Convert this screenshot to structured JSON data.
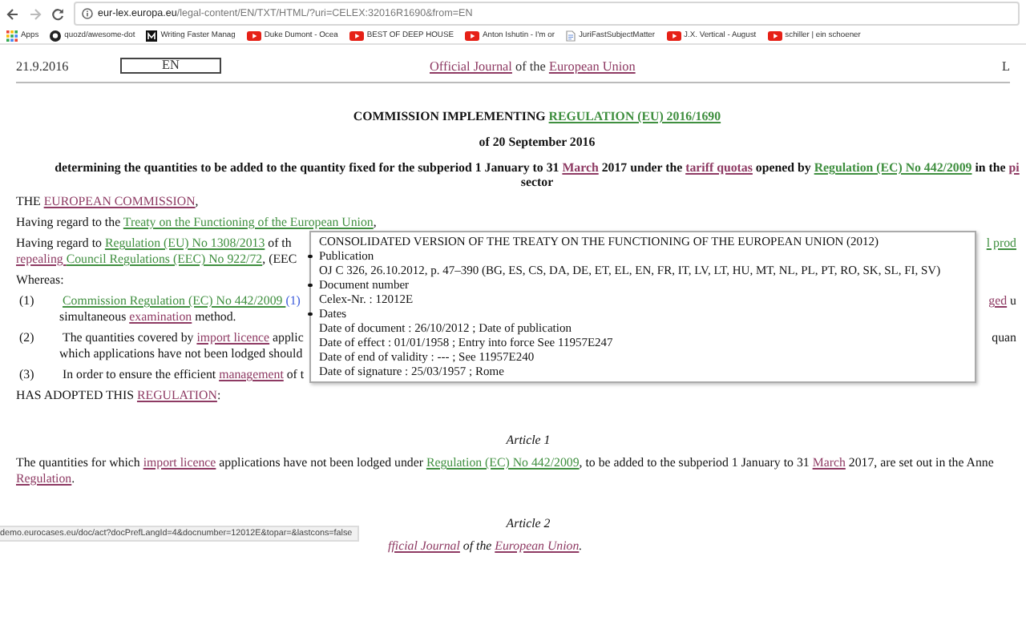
{
  "browser": {
    "url_host": "eur-lex.europa.eu",
    "url_path": "/legal-content/EN/TXT/HTML/?uri=CELEX:32016R1690&from=EN",
    "bookmarks": [
      {
        "label": "Apps",
        "kind": "apps"
      },
      {
        "label": "quozd/awesome-dot",
        "kind": "github"
      },
      {
        "label": "Writing Faster Manag",
        "kind": "medium"
      },
      {
        "label": "Duke Dumont - Ocea",
        "kind": "youtube"
      },
      {
        "label": "BEST OF DEEP HOUSE",
        "kind": "youtube"
      },
      {
        "label": "Anton Ishutin - I'm or",
        "kind": "youtube"
      },
      {
        "label": "JuriFastSubjectMatter",
        "kind": "document"
      },
      {
        "label": "J.X. Vertical - August",
        "kind": "youtube"
      },
      {
        "label": "schiller | ein schoener",
        "kind": "youtube"
      }
    ]
  },
  "header": {
    "date": "21.9.2016",
    "language": "EN",
    "journal": [
      {
        "kind": "term",
        "text": "Official Journal"
      },
      {
        "kind": "text",
        "text": " of the "
      },
      {
        "kind": "term",
        "text": "European Union"
      }
    ],
    "page_ref": "L"
  },
  "title": [
    [
      {
        "kind": "text",
        "text": "COMMISSION IMPLEMENTING "
      },
      {
        "kind": "reference",
        "text": "REGULATION (EU) 2016/1690"
      }
    ],
    [
      {
        "kind": "text",
        "text": "of 20 September 2016"
      }
    ],
    [
      {
        "kind": "text",
        "text": "determining the quantities to be added to the quantity fixed for the subperiod 1 January to 31 "
      },
      {
        "kind": "term",
        "text": "March"
      },
      {
        "kind": "text",
        "text": " 2017 under the "
      },
      {
        "kind": "term",
        "text": "tariff quotas"
      },
      {
        "kind": "text",
        "text": " opened by "
      },
      {
        "kind": "reference",
        "text": "Regulation (EC) No 442/2009"
      },
      {
        "kind": "text",
        "text": " in the "
      },
      {
        "kind": "term",
        "text": "pi"
      }
    ],
    [
      {
        "kind": "text",
        "text": "sector"
      }
    ]
  ],
  "body": [
    {
      "kind": "para",
      "segments": [
        {
          "kind": "text",
          "text": "THE "
        },
        {
          "kind": "term",
          "text": "EUROPEAN COMMISSION"
        },
        {
          "kind": "text",
          "text": ","
        }
      ]
    },
    {
      "kind": "para",
      "segments": [
        {
          "kind": "text",
          "text": "Having regard to the "
        },
        {
          "kind": "reference",
          "text": "Treaty on the Functioning of the European Union"
        },
        {
          "kind": "text",
          "text": ","
        }
      ]
    },
    {
      "kind": "para",
      "segments": [
        {
          "kind": "text",
          "text": "Having regard to "
        },
        {
          "kind": "reference",
          "text": "Regulation (EU) No 1308/2013"
        },
        {
          "kind": "text",
          "text": " of th"
        }
      ],
      "right": [
        {
          "kind": "reference",
          "text": "l prod"
        }
      ]
    },
    {
      "kind": "para_cont",
      "segments": [
        {
          "kind": "term",
          "text": "repealing "
        },
        {
          "kind": "reference",
          "text": "Council Regulations (EEC) No 922/72"
        },
        {
          "kind": "text",
          "text": ", (EEC"
        }
      ]
    },
    {
      "kind": "para",
      "segments": [
        {
          "kind": "text",
          "text": "Whereas:"
        }
      ]
    },
    {
      "kind": "item",
      "number": "(1)",
      "segments": [
        {
          "kind": "reference",
          "text": "Commission Regulation (EC) No 442/2009 "
        },
        {
          "kind": "footnote",
          "text": "(1)"
        }
      ],
      "right": [
        {
          "kind": "term",
          "text": "ged"
        },
        {
          "kind": "text",
          "text": " u"
        }
      ]
    },
    {
      "kind": "item_cont",
      "segments": [
        {
          "kind": "text",
          "text": "simultaneous "
        },
        {
          "kind": "term",
          "text": "examination"
        },
        {
          "kind": "text",
          "text": " method."
        }
      ]
    },
    {
      "kind": "item",
      "number": "(2)",
      "segments": [
        {
          "kind": "text",
          "text": "The quantities covered by "
        },
        {
          "kind": "term",
          "text": "import licence"
        },
        {
          "kind": "text",
          "text": " applic"
        }
      ],
      "right": [
        {
          "kind": "text",
          "text": "quan"
        }
      ]
    },
    {
      "kind": "item_cont",
      "segments": [
        {
          "kind": "text",
          "text": "which applications have not been lodged should"
        }
      ]
    },
    {
      "kind": "item",
      "number": "(3)",
      "segments": [
        {
          "kind": "text",
          "text": "In order to ensure the efficient "
        },
        {
          "kind": "term",
          "text": "management"
        },
        {
          "kind": "text",
          "text": " of t"
        }
      ]
    },
    {
      "kind": "para",
      "segments": [
        {
          "kind": "text",
          "text": "HAS ADOPTED THIS "
        },
        {
          "kind": "term",
          "text": "REGULATION"
        },
        {
          "kind": "text",
          "text": ":"
        }
      ]
    },
    {
      "kind": "article",
      "segments": [
        {
          "kind": "text",
          "text": "Article 1"
        }
      ]
    },
    {
      "kind": "para",
      "segments": [
        {
          "kind": "text",
          "text": "The quantities for which "
        },
        {
          "kind": "term",
          "text": "import licence"
        },
        {
          "kind": "text",
          "text": " applications have not been lodged under "
        },
        {
          "kind": "reference",
          "text": "Regulation (EC) No 442/2009"
        },
        {
          "kind": "text",
          "text": ", to be added to the subperiod 1 January to 31 "
        },
        {
          "kind": "term",
          "text": "March"
        },
        {
          "kind": "text",
          "text": " 2017, are set out in the Anne"
        }
      ]
    },
    {
      "kind": "para_cont",
      "segments": [
        {
          "kind": "term",
          "text": "Regulation"
        },
        {
          "kind": "text",
          "text": "."
        }
      ]
    },
    {
      "kind": "article",
      "segments": [
        {
          "kind": "text",
          "text": "Article 2"
        }
      ]
    },
    {
      "kind": "partial",
      "segments": [
        {
          "kind": "term",
          "text": "fficial Journal"
        },
        {
          "kind": "text",
          "text": " of the "
        },
        {
          "kind": "term",
          "text": "European Union"
        },
        {
          "kind": "text",
          "text": "."
        }
      ]
    }
  ],
  "tooltip": {
    "title": "CONSOLIDATED VERSION OF THE TREATY ON THE FUNCTIONING OF THE EUROPEAN UNION (2012)",
    "sections": [
      {
        "heading": "Publication",
        "lines": [
          "OJ C 326, 26.10.2012, p. 47–390 (BG, ES, CS, DA, DE, ET, EL, EN, FR, IT, LV, LT, HU, MT, NL, PL, PT, RO, SK, SL, FI, SV)"
        ]
      },
      {
        "heading": "Document number",
        "lines": [
          "Celex-Nr. : 12012E"
        ]
      },
      {
        "heading": "Dates",
        "lines": [
          "Date of document : 26/10/2012 ; Date of publication",
          "Date of effect : 01/01/1958 ; Entry into force See 11957E247",
          "Date of end of validity : --- ; See 11957E240",
          "Date of signature : 25/03/1957 ; Rome"
        ]
      }
    ]
  },
  "status_url": "demo.eurocases.eu/doc/act?docPrefLangId=4&docnumber=12012E&topar=&lastcons=false"
}
